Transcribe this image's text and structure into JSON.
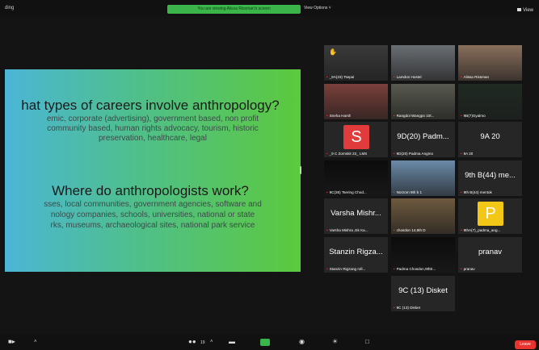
{
  "topbar": {
    "recording_label": "ding",
    "share_banner": "You are viewing Alissa Rissman's screen",
    "view_options": "View Options ˅",
    "view_button": "View"
  },
  "slide": {
    "heading1": "hat types of careers involve anthropology?",
    "body1": [
      "emic, corporate (advertising), government based, non profit",
      "community based, human rights advocacy, tourism, historic",
      "preservation, healthcare, legal"
    ],
    "heading2": "Where do anthropologists work?",
    "body2": [
      "sses, local communities, government agencies, software and",
      "nology companies, schools, universities, national or state",
      "rks, museums, archaeological sites, national park service"
    ]
  },
  "participants": [
    {
      "name": "_9A(23) Tsepal",
      "display": "",
      "type": "video",
      "color": "#3a3a3a",
      "hand": true
    },
    {
      "name": "Lamdon Hostel",
      "display": "",
      "type": "video",
      "color": "#6a6f74"
    },
    {
      "name": "Alissa Rissman",
      "display": "",
      "type": "video",
      "color": "#8a6f5c",
      "active": true
    },
    {
      "name": "Sneha Harsh",
      "display": "",
      "type": "video",
      "color": "#7a3f3a"
    },
    {
      "name": "Rangdol Wangpo 10t...",
      "display": "",
      "type": "video",
      "color": "#585a4e"
    },
    {
      "name": "9B(7)Gyalmo",
      "display": "",
      "type": "video",
      "color": "#1f2a22"
    },
    {
      "name": "_9 C Zomskit 23_ LMS",
      "display": "S",
      "type": "avatar",
      "color": "#e23b3b"
    },
    {
      "name": "9D(20) Padma Angmo",
      "display": "9D(20) Padm...",
      "type": "text"
    },
    {
      "name": "9A 20",
      "display": "9A 20",
      "type": "text"
    },
    {
      "name": "9C(35) Tsering Chod...",
      "display": "",
      "type": "video",
      "color": "#0c0c0c"
    },
    {
      "name": "Norzom 9th b 1",
      "display": "",
      "type": "video",
      "color": "#6b8aa8"
    },
    {
      "name": "9th B(44) mentok",
      "display": "9th B(44) me...",
      "type": "text"
    },
    {
      "name": "Varsha Mishra ,Ek Ka...",
      "display": "Varsha Mishr...",
      "type": "text"
    },
    {
      "name": "chosdon 14,9th D",
      "display": "",
      "type": "video",
      "color": "#6e5a3f"
    },
    {
      "name": "9thA(7)_padma_ang...",
      "display": "P",
      "type": "avatar",
      "color": "#f3c715"
    },
    {
      "name": "Stanzin Rigzang roll...",
      "display": "Stanzin Rigza...",
      "type": "text"
    },
    {
      "name": "Padma Chosdon,9thE...",
      "display": "",
      "type": "video",
      "color": "#0c0c0c"
    },
    {
      "name": "pranav",
      "display": "pranav",
      "type": "text"
    },
    {
      "name": "9C (13) Disket",
      "display": "9C (13) Disket",
      "type": "text"
    }
  ],
  "bottombar": {
    "participants_count": "19",
    "leave_label": "Leave"
  },
  "colors": {
    "active_speaker_border": "#4ec24a",
    "leave_button": "#e8332e",
    "muted_mic": "#ff3b30",
    "share_banner": "#3bb54a"
  }
}
